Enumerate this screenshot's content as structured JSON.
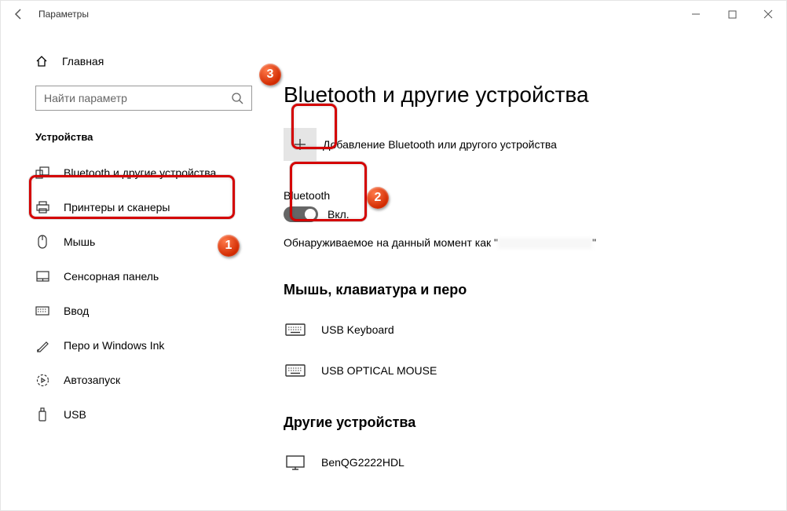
{
  "window": {
    "title": "Параметры"
  },
  "sidebar": {
    "home": "Главная",
    "search_placeholder": "Найти параметр",
    "section": "Устройства",
    "items": [
      "Bluetooth и другие устройства",
      "Принтеры и сканеры",
      "Мышь",
      "Сенсорная панель",
      "Ввод",
      "Перо и Windows Ink",
      "Автозапуск",
      "USB"
    ]
  },
  "main": {
    "title": "Bluetooth и другие устройства",
    "add_label": "Добавление Bluetooth или другого устройства",
    "bt_label": "Bluetooth",
    "bt_state": "Вкл.",
    "discover_prefix": "Обнаруживаемое на данный момент как \"",
    "discover_suffix": "\"",
    "section_input": "Мышь, клавиатура и перо",
    "devices_input": [
      "USB Keyboard",
      "USB OPTICAL MOUSE"
    ],
    "section_other": "Другие устройства",
    "devices_other": [
      "BenQG2222HDL"
    ]
  },
  "annotations": {
    "1": "1",
    "2": "2",
    "3": "3"
  }
}
